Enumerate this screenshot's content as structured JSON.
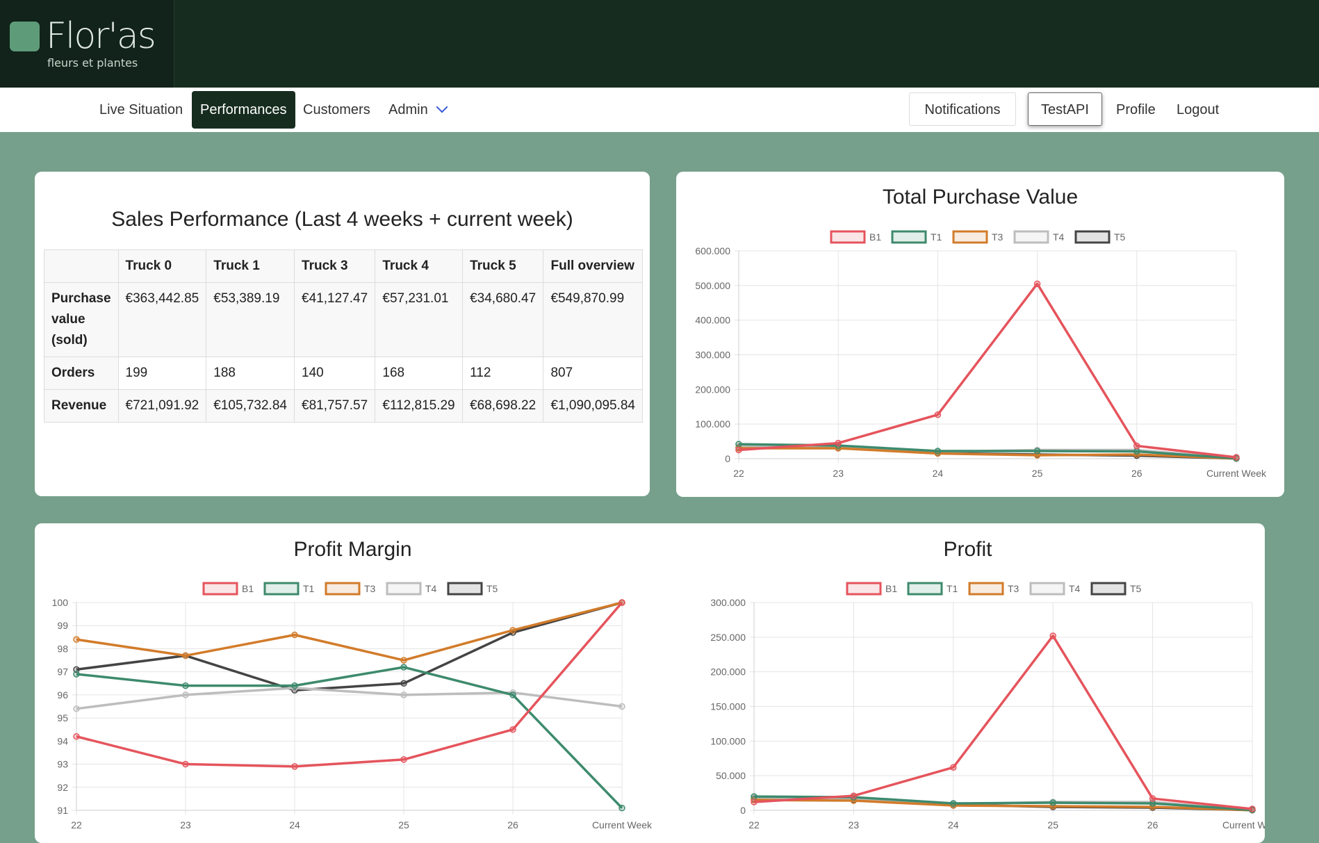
{
  "app": {
    "logo_name": "Flor'as",
    "logo_tagline": "fleurs et plantes"
  },
  "nav": {
    "live_situation": "Live Situation",
    "performances": "Performances",
    "customers": "Customers",
    "admin": "Admin",
    "notifications": "Notifications",
    "testapi": "TestAPI",
    "profile": "Profile",
    "logout": "Logout"
  },
  "sales": {
    "title": "Sales Performance (Last 4 weeks + current week)",
    "columns": [
      "",
      "Truck 0",
      "Truck 1",
      "Truck 3",
      "Truck 4",
      "Truck 5",
      "Full overview"
    ],
    "rows": [
      {
        "label": "Purchase value (sold)",
        "values": [
          "€363,442.85",
          "€53,389.19",
          "€41,127.47",
          "€57,231.01",
          "€34,680.47",
          "€549,870.99"
        ]
      },
      {
        "label": "Orders",
        "values": [
          "199",
          "188",
          "140",
          "168",
          "112",
          "807"
        ]
      },
      {
        "label": "Revenue",
        "values": [
          "€721,091.92",
          "€105,732.84",
          "€81,757.57",
          "€112,815.29",
          "€68,698.22",
          "€1,090,095.84"
        ]
      }
    ]
  },
  "colors": {
    "B1": "#e5545c",
    "T1": "#3d8a6d",
    "T3": "#d27b2a",
    "T4": "#bdbdbd",
    "T5": "#444444"
  },
  "chart_data": [
    {
      "type": "line",
      "title": "Total Purchase Value",
      "x": [
        "22",
        "23",
        "24",
        "25",
        "26",
        "Current Week"
      ],
      "ylim": [
        0,
        600000
      ],
      "yticks": [
        "0",
        "100.000",
        "200.000",
        "300.000",
        "400.000",
        "500.000",
        "600.000"
      ],
      "series": [
        {
          "name": "B1",
          "values": [
            25000,
            45000,
            127000,
            505000,
            37000,
            4000
          ]
        },
        {
          "name": "T1",
          "values": [
            42000,
            38000,
            22000,
            22000,
            21000,
            1000
          ]
        },
        {
          "name": "T3",
          "values": [
            30000,
            30000,
            15000,
            10000,
            12000,
            500
          ]
        },
        {
          "name": "T4",
          "values": [
            35000,
            35000,
            20000,
            25000,
            25000,
            1000
          ]
        },
        {
          "name": "T5",
          "values": [
            32000,
            31000,
            16000,
            12000,
            9000,
            500
          ]
        }
      ],
      "legend": "top"
    },
    {
      "type": "line",
      "title": "Profit Margin",
      "x": [
        "22",
        "23",
        "24",
        "25",
        "26",
        "Current Week"
      ],
      "ylim": [
        91,
        100
      ],
      "yticks": [
        "91",
        "92",
        "93",
        "94",
        "95",
        "96",
        "97",
        "98",
        "99",
        "100"
      ],
      "series": [
        {
          "name": "B1",
          "values": [
            94.2,
            93.0,
            92.9,
            93.2,
            94.5,
            100
          ]
        },
        {
          "name": "T1",
          "values": [
            96.9,
            96.4,
            96.4,
            97.2,
            96.0,
            91.1
          ]
        },
        {
          "name": "T3",
          "values": [
            98.4,
            97.7,
            98.6,
            97.5,
            98.8,
            100
          ]
        },
        {
          "name": "T4",
          "values": [
            95.4,
            96.0,
            96.3,
            96.0,
            96.1,
            95.5
          ]
        },
        {
          "name": "T5",
          "values": [
            97.1,
            97.7,
            96.2,
            96.5,
            98.7,
            100
          ]
        }
      ],
      "legend": "top"
    },
    {
      "type": "line",
      "title": "Profit",
      "x": [
        "22",
        "23",
        "24",
        "25",
        "26",
        "Current Week"
      ],
      "ylim": [
        0,
        300000
      ],
      "yticks": [
        "0",
        "50.000",
        "100.000",
        "150.000",
        "200.000",
        "250.000",
        "300.000"
      ],
      "series": [
        {
          "name": "B1",
          "values": [
            12000,
            21000,
            62000,
            252000,
            17000,
            2000
          ]
        },
        {
          "name": "T1",
          "values": [
            20000,
            19000,
            10000,
            11000,
            10000,
            500
          ]
        },
        {
          "name": "T3",
          "values": [
            15000,
            14000,
            7000,
            6000,
            5000,
            300
          ]
        },
        {
          "name": "T4",
          "values": [
            18000,
            17000,
            9000,
            12000,
            12000,
            500
          ]
        },
        {
          "name": "T5",
          "values": [
            16000,
            15000,
            8000,
            5000,
            4000,
            300
          ]
        }
      ],
      "legend": "top"
    }
  ]
}
